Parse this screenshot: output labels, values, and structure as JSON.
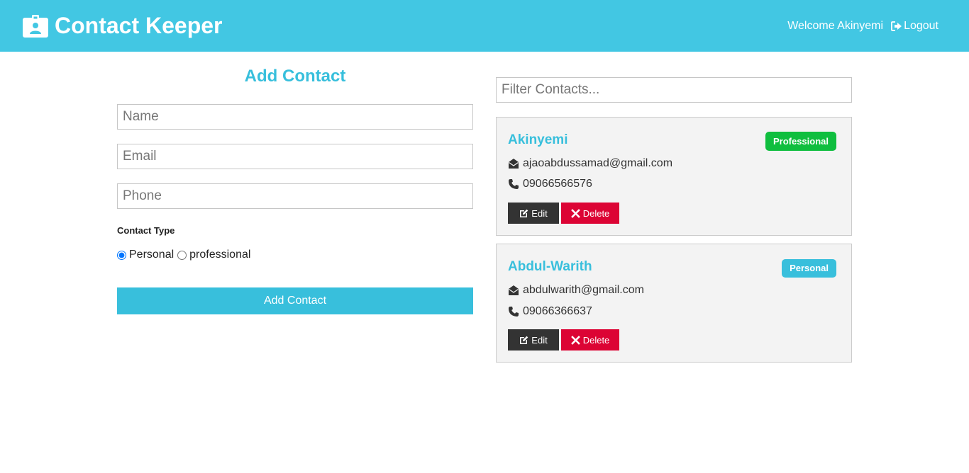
{
  "navbar": {
    "title": "Contact Keeper",
    "brand_icon": "id-badge-icon",
    "welcome_text": "Welcome Akinyemi",
    "logout_label": "Logout",
    "logout_icon": "sign-out-icon",
    "background": "#42c7e3"
  },
  "form": {
    "title": "Add Contact",
    "name_placeholder": "Name",
    "email_placeholder": "Email",
    "phone_placeholder": "Phone",
    "type_label": "Contact Type",
    "radio_personal": "Personal",
    "radio_professional": "professional",
    "selected_type": "personal",
    "submit_label": "Add Contact"
  },
  "filter": {
    "placeholder": "Filter Contacts..."
  },
  "contacts": [
    {
      "name": "Akinyemi",
      "email": "ajaoabdussamad@gmail.com",
      "phone": "09066566576",
      "type": "Professional",
      "badge_color": "#0fbe3e",
      "edit_label": "Edit",
      "delete_label": "Delete"
    },
    {
      "name": "Abdul-Warith",
      "email": "abdulwarith@gmail.com",
      "phone": "09066366637",
      "type": "Personal",
      "badge_color": "#38bfdc",
      "edit_label": "Edit",
      "delete_label": "Delete"
    }
  ],
  "colors": {
    "primary": "#38bfdc",
    "dark": "#333333",
    "danger": "#dc0434",
    "success": "#0fbe3e"
  }
}
